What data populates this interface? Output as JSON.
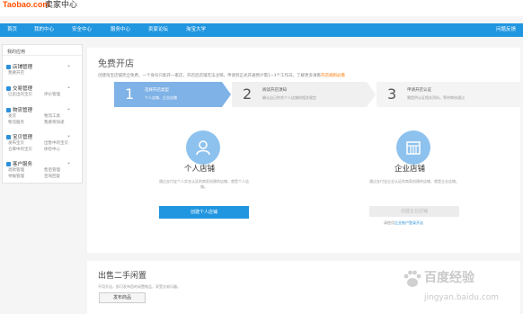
{
  "topbar": {
    "logo": "Taobao.com",
    "brand": "卖家中心"
  },
  "nav": {
    "items": [
      "首页",
      "我的中心",
      "安全中心",
      "服务中心",
      "卖家论坛",
      "淘宝大学"
    ],
    "right": "问题反馈"
  },
  "sidebar": {
    "header": "我的应用",
    "groups": [
      {
        "title": "店铺管理",
        "subs": [
          "我要开店"
        ]
      },
      {
        "title": "交易管理",
        "subs": [
          "已卖出的宝贝",
          "评价管理"
        ]
      },
      {
        "title": "物流管理",
        "subs": [
          "发货",
          "物流工具",
          "物流服务",
          "我要寄快递"
        ]
      },
      {
        "title": "宝贝管理",
        "subs": [
          "发布宝贝",
          "出售中的宝贝",
          "仓库中的宝贝",
          "体检中心"
        ]
      },
      {
        "title": "客户服务",
        "subs": [
          "退款管理",
          "售后管理",
          "举报管理",
          "咨询回复"
        ]
      }
    ]
  },
  "main": {
    "title": "免费开店",
    "desc": "创建淘宝店铺完全免费，一个身份只能开一家店，开店后店铺无法注销，申请到正式开通预计需1~3个工作日。了解更多请看",
    "desc_link": "开店规则必看",
    "steps": [
      {
        "num": "1",
        "title": "选择开店类型",
        "desc": "个人店铺、企业店铺"
      },
      {
        "num": "2",
        "title": "阅读开店须知",
        "desc": "确认自己符合个人店铺的相关规定"
      },
      {
        "num": "3",
        "title": "申请开店认证",
        "desc": "需提供认证相关资料，等待审核通过"
      }
    ],
    "personal": {
      "title": "个人店铺",
      "desc": "通过支付宝个人实名认证的商家创建的店铺，就是个人店铺。",
      "button": "创建个人店铺"
    },
    "enterprise": {
      "title": "企业店铺",
      "desc": "通过支付宝企业认证的商家创建的店铺，就是企业店铺。",
      "button": "创建企业店铺",
      "hint": "请使用",
      "hint_link": "企业账户登录开店"
    }
  },
  "sell": {
    "title": "出售二手闲置",
    "desc": "不用开店，即可发布您的闲置物品，享受交易乐趣。",
    "button": "发布商品"
  },
  "watermark": {
    "text": "百度经验",
    "url": "jingyan.baidu.com"
  },
  "colors": {
    "nav": "#2196e0",
    "accent": "#ff7a00",
    "step_active": "#7fb2e6",
    "icon_circle": "#8ec2ee"
  }
}
